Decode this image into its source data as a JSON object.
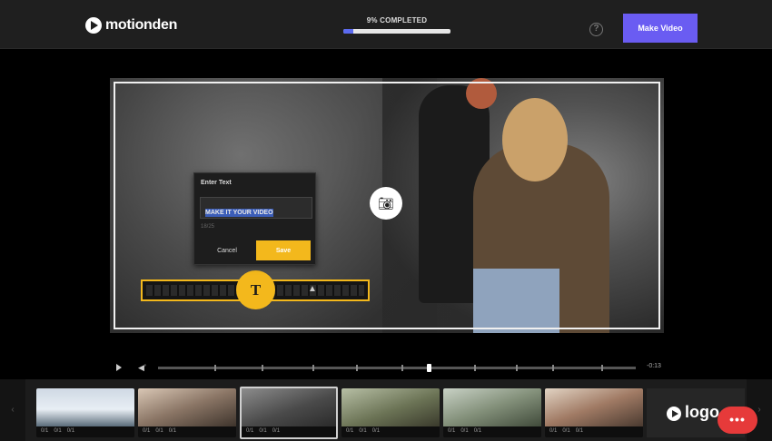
{
  "header": {
    "brand": "motionden",
    "progress_label": "9% COMPLETED",
    "progress_percent": 9,
    "help_icon": "help-circle-icon",
    "make_video_label": "Make Video",
    "accent_color": "#6a5cf2"
  },
  "editor": {
    "dialog": {
      "title": "Enter Text",
      "input_value": "MAKE IT YOUR VIDEO",
      "char_count": "18/25",
      "cancel_label": "Cancel",
      "save_label": "Save"
    },
    "text_handle_glyph": "T",
    "camera_icon": "camera-icon",
    "highlight_color": "#f3b81c"
  },
  "player": {
    "time": "-0:13"
  },
  "filmstrip": {
    "thumbnails": [
      {
        "meta1": "0/1",
        "meta2": "0/1",
        "meta3": "0/1"
      },
      {
        "meta1": "0/1",
        "meta2": "0/1",
        "meta3": "0/1"
      },
      {
        "meta1": "0/1",
        "meta2": "0/1",
        "meta3": "0/1"
      },
      {
        "meta1": "0/1",
        "meta2": "0/1",
        "meta3": "0/1"
      },
      {
        "meta1": "0/1",
        "meta2": "0/1",
        "meta3": "0/1"
      },
      {
        "meta1": "0/1",
        "meta2": "0/1",
        "meta3": "0/1"
      }
    ],
    "logo_card_text": "logo"
  },
  "chat": {
    "icon": "chat-dots-icon",
    "glyph": "•••"
  }
}
